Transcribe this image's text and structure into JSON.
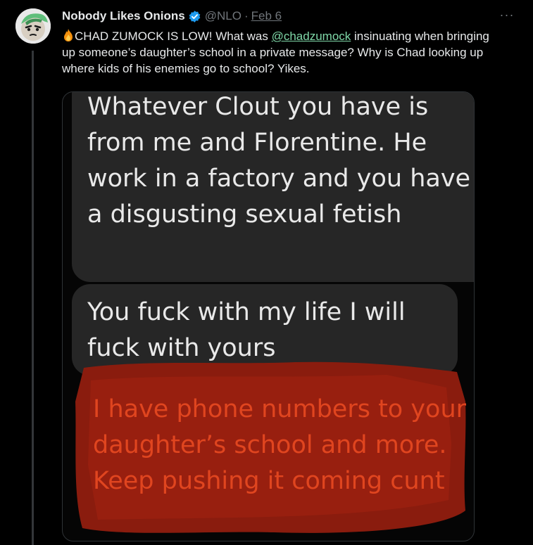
{
  "author": {
    "display_name": "Nobody Likes Onions",
    "handle": "@NLO",
    "separator": "·",
    "date": "Feb 6"
  },
  "tweet": {
    "text_prefix": "CHAD ZUMOCK IS LOW! What was ",
    "mention": "@chadzumock",
    "text_suffix": " insinuating when bringing up someone’s daughter’s school in a private message? Why is Chad looking up where kids of his enemies go to school? Yikes."
  },
  "more_label": "···",
  "media": {
    "messages": [
      "Whatever Clout you have is from me and Florentine. He work in a factory and you have a disgusting sexual fetish",
      "You fuck with my life I will fuck with yours",
      "I have phone numbers to your daughter’s school and more. Keep pushing it coming cunt"
    ]
  },
  "colors": {
    "background": "#000000",
    "text": "#e7e9ea",
    "muted": "#71767b",
    "mention": "#7fd8a8",
    "verified": "#1d9bf0",
    "bubble": "#262626",
    "highlight": "#8a1c0e",
    "highlight_text": "#e0451f"
  },
  "icons": {
    "verified": "verified-badge-icon",
    "fire": "fire-emoji-icon",
    "more": "more-dots-icon"
  }
}
